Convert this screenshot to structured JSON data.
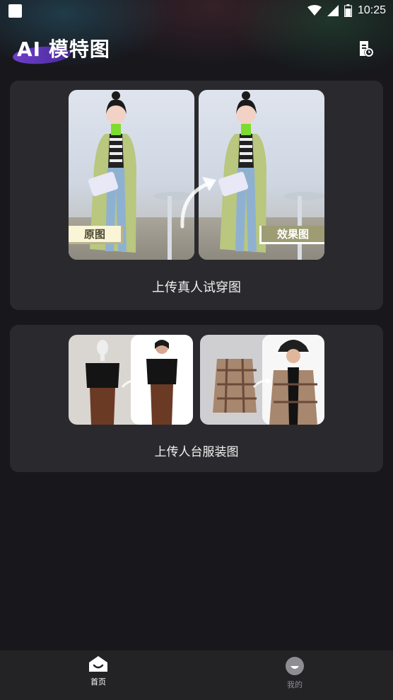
{
  "status_bar": {
    "time": "10:25",
    "icons": [
      "notification-box-icon",
      "wifi-icon",
      "signal-icon",
      "battery-icon"
    ]
  },
  "header": {
    "title": "AI 模特图",
    "history_icon": "history-doc-icon"
  },
  "card_tryon": {
    "original_tag": "原图",
    "effect_tag": "效果图",
    "label": "上传真人试穿图"
  },
  "card_mannequin": {
    "label": "上传人台服装图"
  },
  "bottom_nav": {
    "items": [
      {
        "label": "首页",
        "icon": "home-icon",
        "active": true
      },
      {
        "label": "我的",
        "icon": "profile-icon",
        "active": false
      }
    ]
  },
  "colors": {
    "background": "#17171c",
    "card": "#2a2a2e",
    "nav": "#232326",
    "logo_accent": "#6d3fc9",
    "tag_original_bg": "#fbf5d7",
    "tag_effect_bg": "#9e9c73"
  }
}
